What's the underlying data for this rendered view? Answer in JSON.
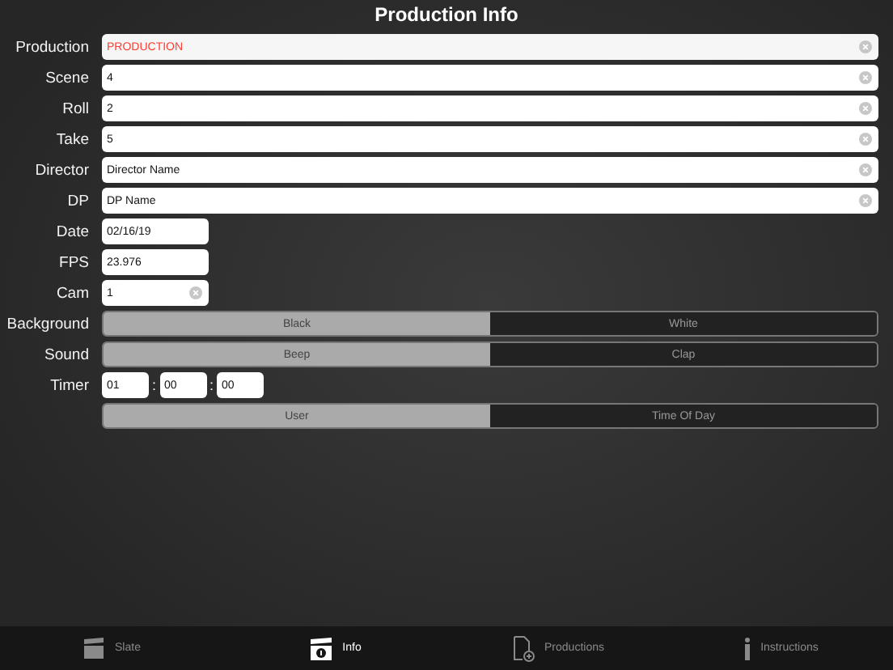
{
  "title": "Production Info",
  "fields": [
    {
      "label": "Production",
      "value": "PRODUCTION",
      "kind": "wide",
      "clear_button": true,
      "color": "#ff3b30"
    },
    {
      "label": "Scene",
      "value": "4",
      "kind": "wide",
      "clear_button": true
    },
    {
      "label": "Roll",
      "value": "2",
      "kind": "wide",
      "clear_button": true
    },
    {
      "label": "Take",
      "value": "5",
      "kind": "wide",
      "clear_button": true
    },
    {
      "label": "Director",
      "value": "Director Name",
      "kind": "wide",
      "clear_button": true
    },
    {
      "label": "DP",
      "value": "DP Name",
      "kind": "wide",
      "clear_button": true
    },
    {
      "label": "Date",
      "value": "02/16/19",
      "kind": "short",
      "clear_button": false
    },
    {
      "label": "FPS",
      "value": "23.976",
      "kind": "short",
      "clear_button": false
    },
    {
      "label": "Cam",
      "value": "1",
      "kind": "short",
      "clear_button": true
    }
  ],
  "background": {
    "label": "Background",
    "options": [
      {
        "label": "Black",
        "selected": true
      },
      {
        "label": "White",
        "selected": false
      }
    ]
  },
  "sound": {
    "label": "Sound",
    "options": [
      {
        "label": "Beep",
        "selected": true
      },
      {
        "label": "Clap",
        "selected": false
      }
    ]
  },
  "timer": {
    "label": "Timer",
    "parts": [
      "01",
      "00",
      "00"
    ],
    "separators": [
      ":",
      ":"
    ],
    "mode": [
      {
        "label": "User",
        "selected": true
      },
      {
        "label": "Time Of Day",
        "selected": false
      }
    ]
  },
  "tabs": [
    {
      "label": "Slate",
      "kind": "slate",
      "selected": false
    },
    {
      "label": "Info",
      "kind": "info-slate",
      "selected": true
    },
    {
      "label": "Productions",
      "kind": "document",
      "selected": false
    },
    {
      "label": "Instructions",
      "kind": "info",
      "selected": false
    }
  ]
}
